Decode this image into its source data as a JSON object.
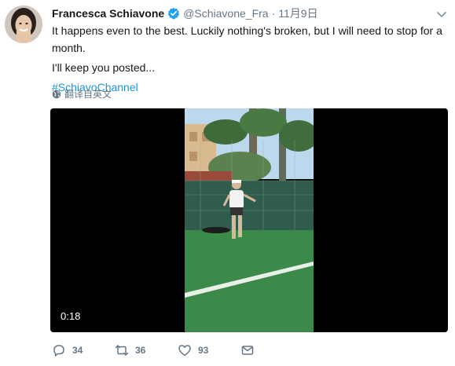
{
  "tweet": {
    "author_name": "Francesca Schiavone",
    "handle": "@Schiavone_Fra",
    "separator": "·",
    "timestamp": "11月9日",
    "text_line_1": "It happens even to the best. Luckily nothing's broken, but I will need to stop for a month.",
    "text_line_2": "I'll keep you posted...",
    "hashtag": "#SchiavoChannel",
    "translate_label": "翻译自英文"
  },
  "video": {
    "duration": "0:18"
  },
  "actions": {
    "replies": "34",
    "retweets": "36",
    "likes": "93"
  },
  "icons": {
    "verified": "verified-badge-icon",
    "caret": "chevron-down-icon",
    "translate": "globe-icon",
    "reply": "reply-icon",
    "retweet": "retweet-icon",
    "like": "heart-icon",
    "dm": "direct-message-icon"
  },
  "colors": {
    "link": "#1b95e0",
    "text": "#14171a",
    "muted": "#657786",
    "verified": "#1da1f2"
  }
}
